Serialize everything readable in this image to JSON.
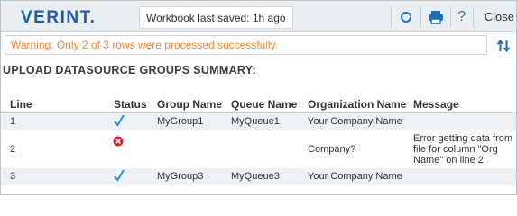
{
  "header": {
    "logo": "VERINT.",
    "saved_status": "Workbook last saved: 1h ago",
    "help_label": "?",
    "close_label": "Close"
  },
  "warning": "Warning: Only 2 of 3 rows were processed successfully.",
  "title": "UPLOAD DATASOURCE GROUPS SUMMARY:",
  "table": {
    "columns": [
      "Line",
      "Status",
      "Group Name",
      "Queue Name",
      "Organization Name",
      "Message"
    ],
    "rows": [
      {
        "line": "1",
        "status": "success",
        "group": "MyGroup1",
        "queue": "MyQueue1",
        "org": "Your Company Name",
        "message": ""
      },
      {
        "line": "2",
        "status": "error",
        "group": "",
        "queue": "",
        "org": "Company?",
        "message": "Error getting data from file for column \"Org Name\" on line 2."
      },
      {
        "line": "3",
        "status": "success",
        "group": "MyGroup3",
        "queue": "MyQueue3",
        "org": "Your Company Name",
        "message": ""
      }
    ]
  },
  "icons": {
    "refresh": "refresh-icon",
    "print": "print-icon",
    "help": "help-icon",
    "sort": "sort-icon",
    "success": "checkmark-icon",
    "error": "error-icon"
  },
  "colors": {
    "brand": "#1e5fa0",
    "warning": "#f0893a",
    "success": "#1a96d4",
    "error": "#d9232e"
  }
}
